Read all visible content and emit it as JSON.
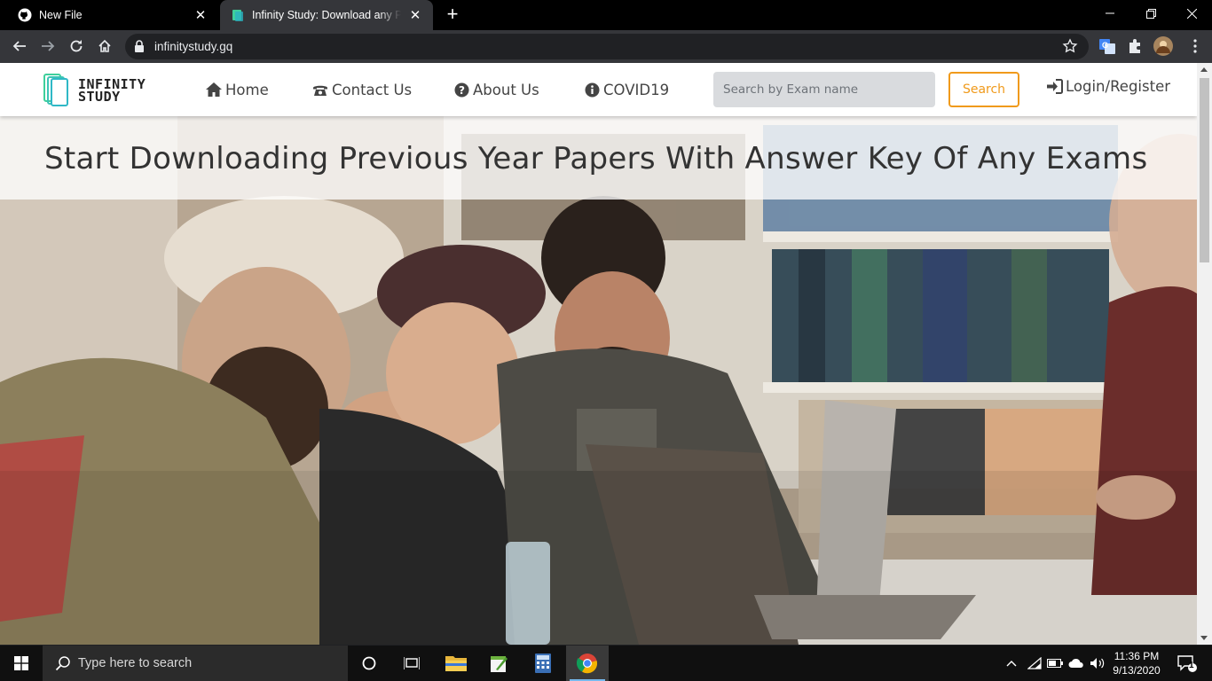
{
  "browser": {
    "tabs": [
      {
        "title": "New File",
        "active": false
      },
      {
        "title": "Infinity Study: Download any Previous Year Papers",
        "active": true
      }
    ],
    "new_tab_symbol": "+",
    "window_controls": [
      "minimize",
      "restore",
      "close"
    ],
    "url": "infinitystudy.gq",
    "extensions": [
      "translate-icon",
      "puzzle-icon",
      "profile-avatar"
    ]
  },
  "site": {
    "logo": {
      "line1": "INFINITY",
      "line2": "STUDY"
    },
    "nav": {
      "home": "Home",
      "contact": "Contact Us",
      "about": "About Us",
      "covid": "COVID19"
    },
    "search": {
      "placeholder": "Search by Exam name",
      "button": "Search"
    },
    "login": "Login/Register",
    "hero": {
      "heading": "Start Downloading Previous Year Papers With Answer Key Of Any Exams"
    },
    "accent_color": "#f09a1b"
  },
  "taskbar": {
    "search_placeholder": "Type here to search",
    "apps": [
      "task-view",
      "file-explorer",
      "notepad-plus",
      "calculator",
      "chrome"
    ],
    "time": "11:36 PM",
    "date": "9/13/2020",
    "notifications": "1"
  }
}
